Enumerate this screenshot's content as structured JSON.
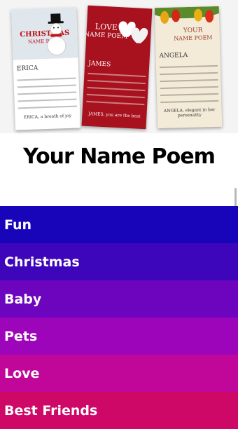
{
  "hero": {
    "cards": [
      {
        "title": "CHRISTMAS",
        "subtitle": "NAME POEM",
        "name": "ERICA",
        "footer": "ERICA, a breath of joy"
      },
      {
        "title": "LOVE",
        "subtitle": "NAME POEM",
        "name": "JAMES",
        "footer": "JAMES, you are the best"
      },
      {
        "title": "YOUR",
        "subtitle": "NAME POEM",
        "name": "ANGELA",
        "footer": "ANGELA, elegant in her personality"
      }
    ]
  },
  "app_title": "Your Name Poem",
  "menu": {
    "items": [
      {
        "label": "Fun",
        "color": "#1804b9"
      },
      {
        "label": "Christmas",
        "color": "#3e06ba"
      },
      {
        "label": "Baby",
        "color": "#6d05be"
      },
      {
        "label": "Pets",
        "color": "#9d05bb"
      },
      {
        "label": "Love",
        "color": "#c1069a"
      },
      {
        "label": "Best Friends",
        "color": "#cd0866"
      }
    ]
  }
}
